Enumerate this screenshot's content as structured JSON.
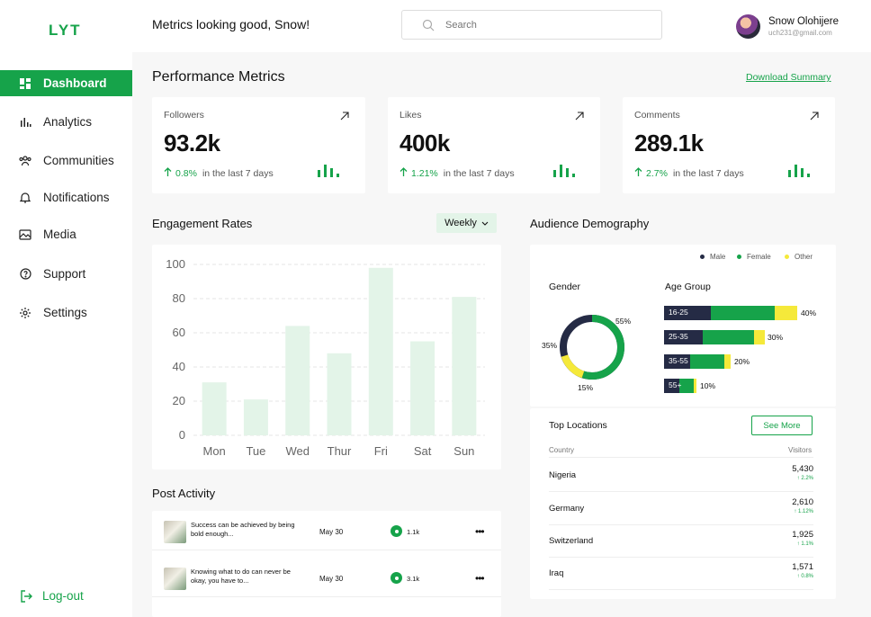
{
  "brand": {
    "logo": "LYT",
    "accent": "#16a34a"
  },
  "sidebar": {
    "items": [
      {
        "label": "Dashboard",
        "icon": "grid-icon",
        "active": true
      },
      {
        "label": "Analytics",
        "icon": "bar-chart-icon"
      },
      {
        "label": "Communities",
        "icon": "users-icon"
      },
      {
        "label": "Notifications",
        "icon": "bell-icon"
      },
      {
        "label": "Media",
        "icon": "image-icon"
      },
      {
        "label": "Support",
        "icon": "help-icon"
      },
      {
        "label": "Settings",
        "icon": "gear-icon"
      }
    ],
    "logout": "Log-out"
  },
  "header": {
    "greeting": "Metrics looking good, Snow!",
    "search_placeholder": "Search",
    "user_name": "Snow Olohijere",
    "user_email": "uch231@gmail.com"
  },
  "performance": {
    "title": "Performance Metrics",
    "download": "Download Summary",
    "cards": [
      {
        "label": "Followers",
        "value": "93.2k",
        "change": "0.8%",
        "period": "in the last 7 days"
      },
      {
        "label": "Likes",
        "value": "400k",
        "change": "1.21%",
        "period": "in the last 7 days"
      },
      {
        "label": "Comments",
        "value": "289.1k",
        "change": "2.7%",
        "period": "in the last 7 days"
      }
    ]
  },
  "engagement": {
    "title": "Engagement Rates",
    "filter": "Weekly"
  },
  "chart_data": {
    "type": "bar",
    "categories": [
      "Mon",
      "Tue",
      "Wed",
      "Thur",
      "Fri",
      "Sat",
      "Sun"
    ],
    "values": [
      31,
      21,
      64,
      48,
      98,
      55,
      81
    ],
    "ylim": [
      0,
      100
    ],
    "yticks": [
      "100",
      "80",
      "60",
      "40",
      "20",
      "0"
    ],
    "color": "#e3f4e8",
    "grid": true
  },
  "demography": {
    "title": "Audience Demography",
    "legend": [
      {
        "label": "Male",
        "color": "#252b45"
      },
      {
        "label": "Female",
        "color": "#16a34a"
      },
      {
        "label": "Other",
        "color": "#f5e93a"
      }
    ],
    "gender_title": "Gender",
    "gender": {
      "female_pct": "55%",
      "male_pct": "35%",
      "other_pct": "15%"
    },
    "age_title": "Age Group",
    "age_groups": [
      {
        "label": "16-25",
        "pct": "40%"
      },
      {
        "label": "25-35",
        "pct": "30%"
      },
      {
        "label": "35-55",
        "pct": "20%"
      },
      {
        "label": "55+",
        "pct": "10%"
      }
    ]
  },
  "locations": {
    "title": "Top Locations",
    "see_more": "See More",
    "col_country": "Country",
    "col_visitors": "Visitors",
    "rows": [
      {
        "country": "Nigeria",
        "visitors": "5,430",
        "change": "2.2%"
      },
      {
        "country": "Germany",
        "visitors": "2,610",
        "change": "1.12%"
      },
      {
        "country": "Switzerland",
        "visitors": "1,925",
        "change": "1.1%"
      },
      {
        "country": "Iraq",
        "visitors": "1,571",
        "change": "0.8%"
      }
    ]
  },
  "posts": {
    "title": "Post Activity",
    "rows": [
      {
        "text": "Success can be achieved by being bold enough...",
        "date": "May 30",
        "views": "1.1k"
      },
      {
        "text": "Knowing what to do can never be okay, you have to...",
        "date": "May 30",
        "views": "3.1k"
      }
    ]
  }
}
